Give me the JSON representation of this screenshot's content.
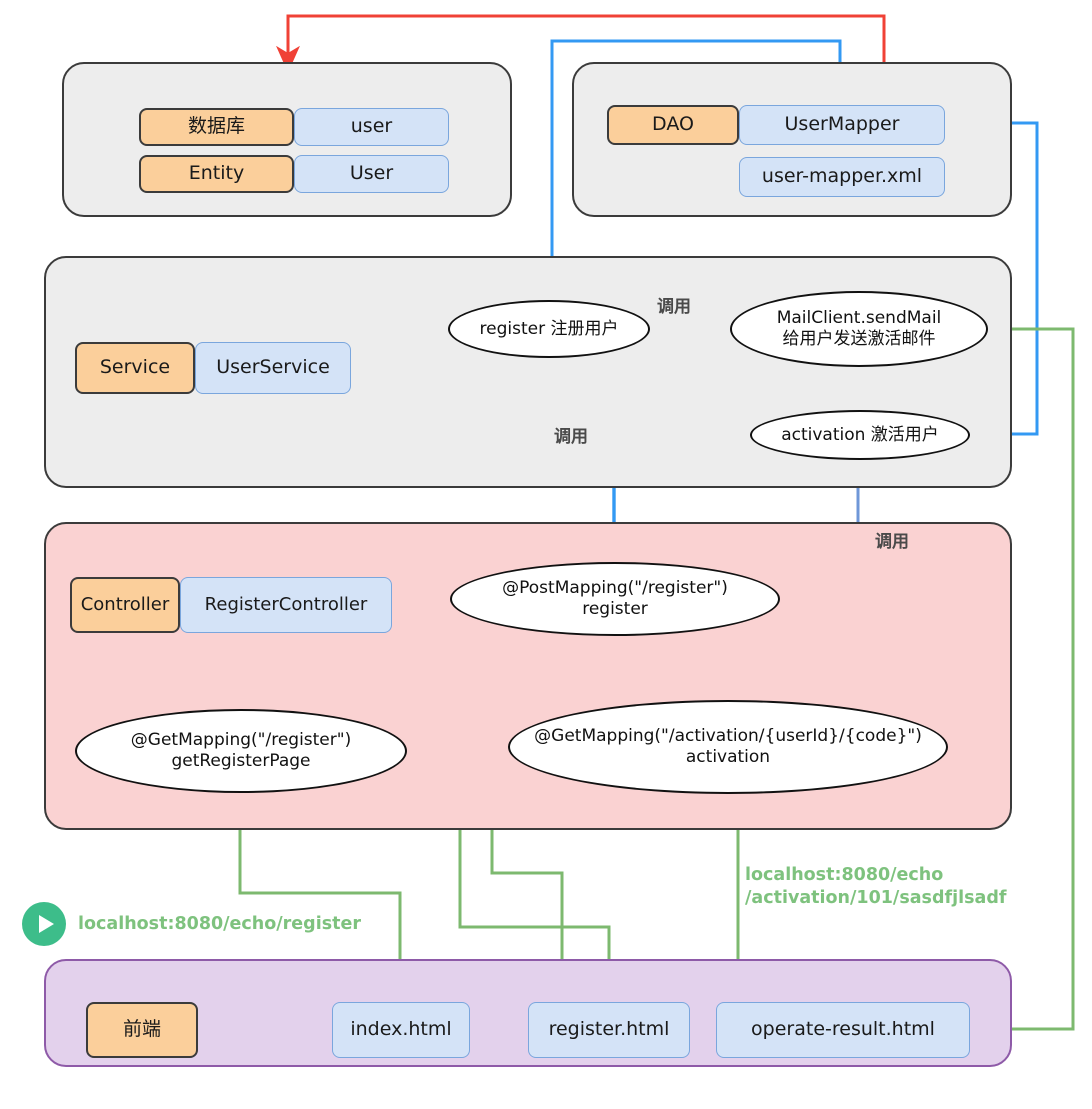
{
  "diagram": {
    "title": "Spring Boot register/activation flow",
    "colors": {
      "grey_layer": "#ededed",
      "pink_layer": "#fad2d2",
      "purple_layer": "#e3d1ec",
      "orange_chip": "#fbcf9b",
      "blue_chip": "#d4e3f7",
      "blue_arrow": "#3399f3",
      "red_arrow": "#f04136",
      "green_arrow": "#7db96f",
      "green_text": "#7ec27e",
      "play_badge": "#3dbd8a"
    }
  },
  "db_layer": {
    "rows": [
      {
        "tag": "数据库",
        "value": "user"
      },
      {
        "tag": "Entity",
        "value": "User"
      }
    ]
  },
  "dao_layer": {
    "tag": "DAO",
    "items": [
      {
        "value": "UserMapper"
      },
      {
        "value": "user-mapper.xml"
      }
    ]
  },
  "service_layer": {
    "tag": "Service",
    "value": "UserService",
    "nodes": [
      {
        "id": "register",
        "lines": [
          "register 注册用户"
        ]
      },
      {
        "id": "send-mail",
        "lines": [
          "MailClient.sendMail",
          "给用户发送激活邮件"
        ]
      },
      {
        "id": "activation",
        "lines": [
          "activation 激活用户"
        ]
      }
    ]
  },
  "controller_layer": {
    "tag": "Controller",
    "value": "RegisterController",
    "nodes": [
      {
        "id": "post-register",
        "lines": [
          "@PostMapping(\"/register\")",
          "register"
        ]
      },
      {
        "id": "get-register",
        "lines": [
          "@GetMapping(\"/register\")",
          "getRegisterPage"
        ]
      },
      {
        "id": "get-activation",
        "lines": [
          "@GetMapping(\"/activation/{userId}/{code}\")",
          "activation"
        ]
      }
    ]
  },
  "frontend_layer": {
    "tag": "前端",
    "pages": [
      {
        "value": "index.html"
      },
      {
        "value": "register.html"
      },
      {
        "value": "operate-result.html"
      }
    ]
  },
  "edge_labels": {
    "call_register_to_mail": "调用",
    "call_controller_to_register": "调用",
    "call_controller_to_activation": "调用"
  },
  "urls": {
    "register_url": "localhost:8080/echo/register",
    "activation_url": "localhost:8080/echo\n/activation/101/sasdfjlsadf"
  },
  "icons": {
    "play": "play-icon"
  }
}
